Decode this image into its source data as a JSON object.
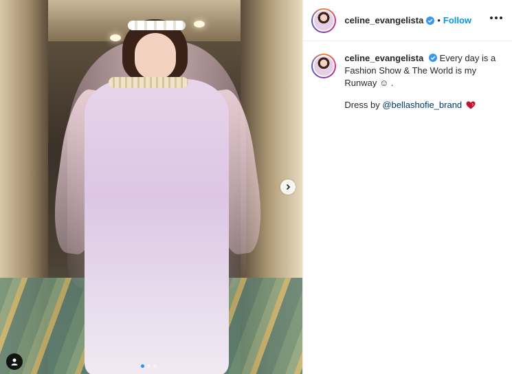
{
  "post": {
    "username": "celine_evangelista",
    "follow_label": "Follow",
    "separator": "•",
    "caption_text": "Every day is a Fashion Show & The World is my Runway ☺ .",
    "credit_prefix": "Dress by",
    "credit_mention": "@bellashofie_brand",
    "carousel": {
      "total_slides": 3,
      "active_slide": 1
    }
  },
  "icons": {
    "verified": "verified-badge-icon",
    "more": "more-options-icon",
    "next": "chevron-right-icon",
    "user_tag": "user-tag-icon",
    "heart": "heart-icon"
  },
  "colors": {
    "accent": "#0095f6",
    "mention": "#00376b",
    "text": "#262626",
    "heart": "#c8102e"
  }
}
